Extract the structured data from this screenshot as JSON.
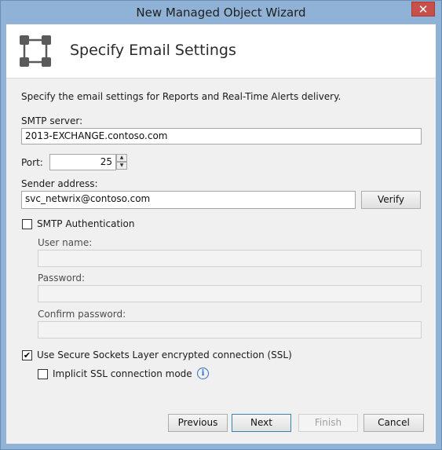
{
  "window": {
    "title": "New Managed Object Wizard",
    "close_glyph": "✕"
  },
  "header": {
    "title": "Specify Email Settings",
    "icon": "network-nodes-icon"
  },
  "intro": "Specify the email settings for Reports and Real-Time Alerts delivery.",
  "smtp": {
    "label": "SMTP server:",
    "value": "2013-EXCHANGE.contoso.com"
  },
  "port": {
    "label": "Port:",
    "value": "25"
  },
  "sender": {
    "label": "Sender address:",
    "value": "svc_netwrix@contoso.com",
    "verify_label": "Verify"
  },
  "auth": {
    "label": "SMTP Authentication",
    "checked": false,
    "username_label": "User name:",
    "password_label": "Password:",
    "confirm_label": "Confirm password:"
  },
  "ssl": {
    "label": "Use Secure Sockets Layer encrypted connection (SSL)",
    "checked": true,
    "check_glyph": "✔"
  },
  "implicit_ssl": {
    "label": "Implicit SSL connection mode",
    "checked": false,
    "info_glyph": "i"
  },
  "buttons": {
    "previous": "Previous",
    "next": "Next",
    "finish": "Finish",
    "cancel": "Cancel"
  }
}
